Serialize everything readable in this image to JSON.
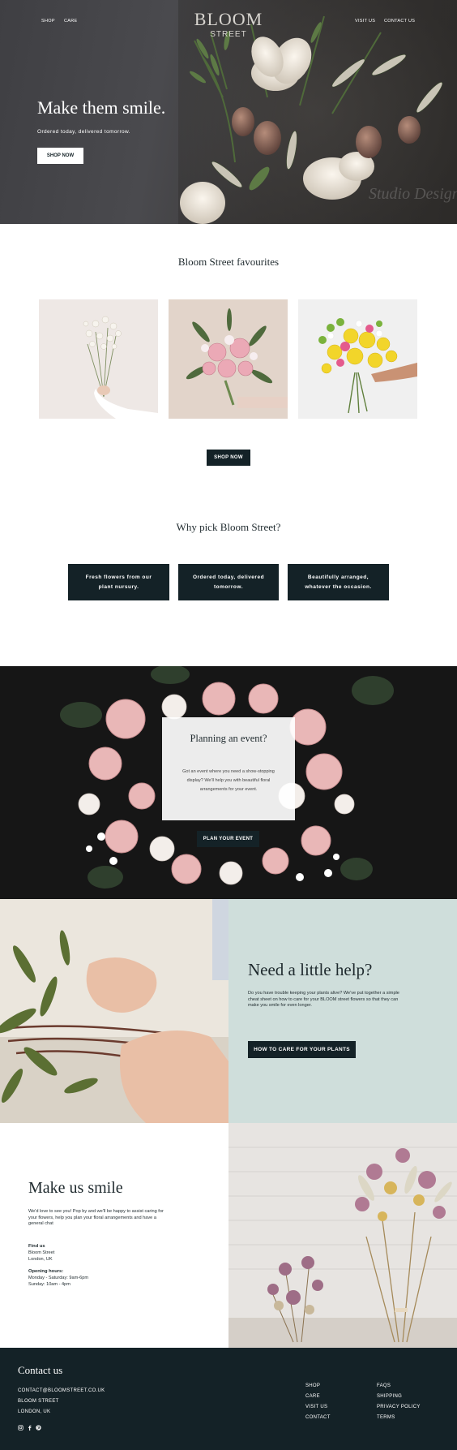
{
  "nav": {
    "left": [
      "SHOP",
      "CARE"
    ],
    "right": [
      "VISIT US",
      "CONTACT US"
    ],
    "logo_main": "BLOOM",
    "logo_sub": "STREET"
  },
  "hero": {
    "heading": "Make them smile.",
    "subheading": "Ordered today, delivered tomorrow.",
    "button": "SHOP NOW",
    "watermark": "Studio Design"
  },
  "favourites": {
    "title": "Bloom Street favourites",
    "products": [
      "white-bouquet",
      "pink-bouquet",
      "yellow-bouquet"
    ],
    "button": "SHOP NOW"
  },
  "why": {
    "title": "Why pick Bloom Street?",
    "cards": [
      "Fresh flowers from our plant nursury.",
      "Ordered today, delivered tomorrow.",
      "Beautifully arranged, whatever the occasion."
    ]
  },
  "event": {
    "title": "Planning an event?",
    "text": "Got an event where you need a show-stopping display? We'll help you with beautiful floral arrangements for your event.",
    "button": "PLAN YOUR EVENT"
  },
  "help": {
    "title": "Need a little help?",
    "text": "Do you have trouble keeping your plants alive? We've put together a simple cheat sheet on how to care for your BLOOM street flowers so that they can make you smile for even longer.",
    "button": "HOW TO CARE FOR YOUR PLANTS"
  },
  "contact": {
    "title": "Make us smile",
    "intro": "We'd love to see you! Pop by and we'll be happy to assist caring for your flowers, help you plan your floral arrangements and have a general chat",
    "find_label": "Find us",
    "address": [
      "Bloom Street",
      "London, UK"
    ],
    "hours_label": "Opening hours:",
    "hours": [
      "Monday - Saturday: 9am-6pm",
      "Sunday: 10am - 4pm"
    ]
  },
  "footer": {
    "title": "Contact us",
    "details": [
      "CONTACT@BLOOMSTREET.CO.UK",
      "BLOOM STREET",
      "LONDON, UK"
    ],
    "links_col1": [
      "SHOP",
      "CARE",
      "VISIT US",
      "CONTACT"
    ],
    "links_col2": [
      "FAQS",
      "SHIPPING",
      "PRIVACY POLICY",
      "TERMS"
    ],
    "social_icons": [
      "instagram-icon",
      "facebook-icon",
      "pinterest-icon"
    ]
  },
  "colors": {
    "dark": "#142227",
    "mint": "#cfdedb",
    "text": "#1f2a2e"
  }
}
